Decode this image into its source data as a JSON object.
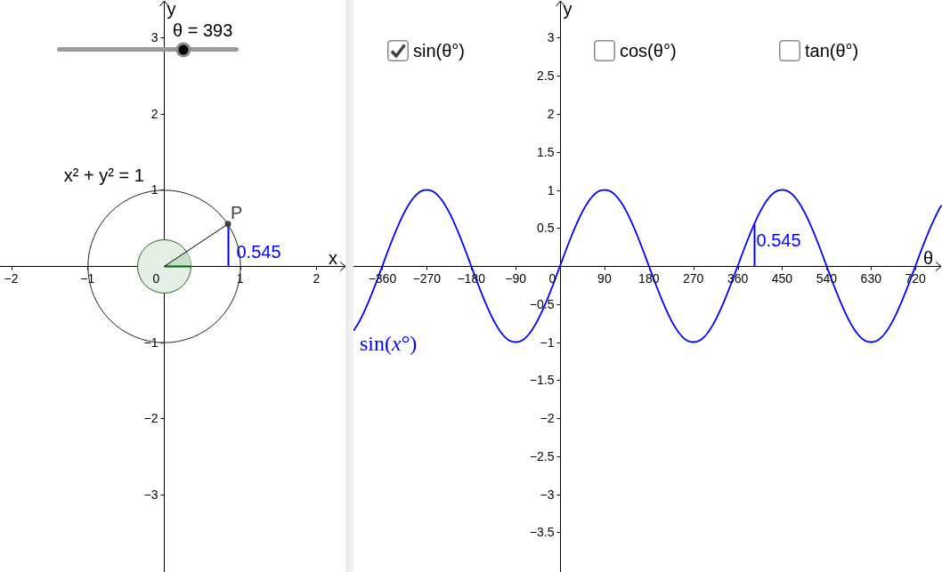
{
  "left_view": {
    "slider": {
      "label": "θ = 393",
      "level": 0.697
    },
    "circle": {
      "equation": "x² + y² = 1"
    },
    "origin_label": "0",
    "chart_data": {
      "type": "scatter",
      "xlabel": "x",
      "ylabel": "y",
      "xlim": [
        -2.147,
        2.392
      ],
      "ylim": [
        -4.014,
        3.489
      ],
      "xticks": [
        {
          "value": -2,
          "label": "−2"
        },
        {
          "value": -1,
          "label": "−1"
        },
        1,
        2
      ],
      "yticks": [
        3,
        2,
        1,
        {
          "value": -1,
          "label": "−1"
        },
        {
          "value": -2,
          "label": "−2"
        },
        {
          "value": -3,
          "label": "−3"
        }
      ],
      "series": [
        {
          "name": "P",
          "color": "#404040",
          "x": [
            0.84
          ],
          "values": [
            0.55
          ]
        }
      ],
      "annotations": [
        {
          "x": 0.84,
          "y": 0.545,
          "text": "0.545"
        }
      ]
    }
  },
  "right_view": {
    "checkboxes": [
      {
        "label": "sin(θ°)",
        "checked": true
      },
      {
        "label": "cos(θ°)",
        "checked": false
      },
      {
        "label": "tan(θ°)",
        "checked": false
      }
    ],
    "origin_label": "0",
    "chart_data": {
      "type": "line",
      "xlabel": "θ",
      "ylabel": "y",
      "xlim": [
        -418.5,
        773.8
      ],
      "ylim": [
        -4.023,
        3.497
      ],
      "xticks": [
        {
          "value": -360,
          "label": "−360"
        },
        {
          "value": -270,
          "label": "−270"
        },
        {
          "value": -180,
          "label": "−180"
        },
        {
          "value": -90,
          "label": "−90"
        },
        90,
        180,
        270,
        360,
        450,
        540,
        630,
        720
      ],
      "yticks": [
        3,
        2.5,
        2,
        1.5,
        1,
        0.5,
        {
          "value": -0.5,
          "label": "−0.5"
        },
        {
          "value": -1,
          "label": "−1"
        },
        {
          "value": -1.5,
          "label": "−1.5"
        },
        {
          "value": -2,
          "label": "−2"
        },
        {
          "value": -2.5,
          "label": "−2.5"
        },
        {
          "value": -3,
          "label": "−3"
        },
        {
          "value": -3.5,
          "label": "−3.5"
        }
      ],
      "x": [
        -418,
        -405,
        -390,
        -375,
        -360,
        -345,
        -330,
        -315,
        -300,
        -285,
        -270,
        -255,
        -240,
        -225,
        -210,
        -195,
        -180,
        -165,
        -150,
        -135,
        -120,
        -105,
        -90,
        -75,
        -60,
        -45,
        -30,
        -15,
        0,
        15,
        30,
        45,
        60,
        75,
        90,
        105,
        120,
        135,
        150,
        165,
        180,
        195,
        210,
        225,
        240,
        255,
        270,
        285,
        300,
        315,
        330,
        345,
        360,
        375,
        390,
        405,
        420,
        435,
        450,
        465,
        480,
        495,
        510,
        525,
        540,
        555,
        570,
        585,
        600,
        615,
        630,
        645,
        660,
        675,
        690,
        705,
        720,
        735,
        750,
        765,
        773
      ],
      "series": [
        {
          "name": "sin(*x*°)",
          "color": "#0000ff",
          "values": [
            -0.85,
            -0.71,
            -0.5,
            -0.26,
            0,
            0.26,
            0.5,
            0.71,
            0.87,
            0.97,
            1,
            0.97,
            0.87,
            0.71,
            0.5,
            0.26,
            0,
            -0.26,
            -0.5,
            -0.71,
            -0.87,
            -0.97,
            -1,
            -0.97,
            -0.87,
            -0.71,
            -0.5,
            -0.26,
            0,
            0.26,
            0.5,
            0.71,
            0.87,
            0.97,
            1,
            0.97,
            0.87,
            0.71,
            0.5,
            0.26,
            0,
            -0.26,
            -0.5,
            -0.71,
            -0.87,
            -0.97,
            -1,
            -0.97,
            -0.87,
            -0.71,
            -0.5,
            -0.26,
            0,
            0.26,
            0.5,
            0.71,
            0.87,
            0.97,
            1,
            0.97,
            0.87,
            0.71,
            0.5,
            0.26,
            0,
            -0.26,
            -0.5,
            -0.71,
            -0.87,
            -0.97,
            -1,
            -0.97,
            -0.87,
            -0.71,
            -0.5,
            -0.26,
            0,
            0.26,
            0.5,
            0.71,
            0.8
          ]
        }
      ],
      "annotations": [
        {
          "x": 393,
          "y": 0.545,
          "text": "0.545"
        }
      ]
    }
  }
}
